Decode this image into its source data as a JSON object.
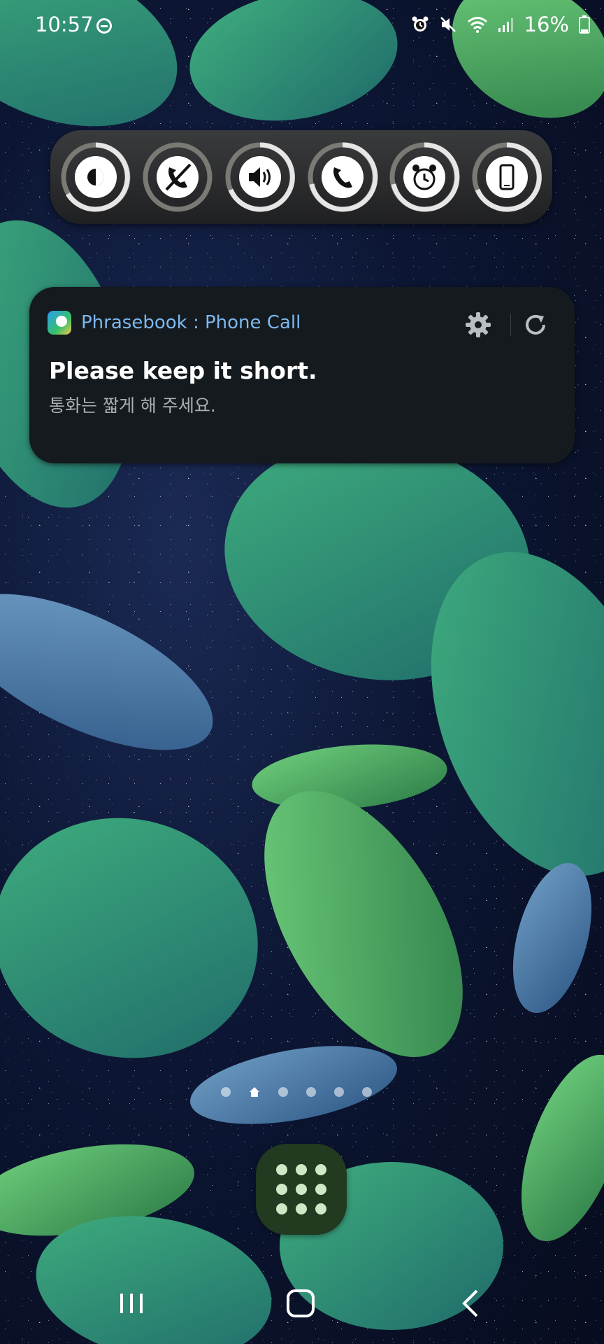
{
  "status_bar": {
    "time": "10:57",
    "battery": "16%"
  },
  "quick_toggles": [
    {
      "icon": "brightness-icon"
    },
    {
      "icon": "call-block-icon"
    },
    {
      "icon": "volume-icon"
    },
    {
      "icon": "phone-icon"
    },
    {
      "icon": "alarm-icon"
    },
    {
      "icon": "phone-device-icon"
    }
  ],
  "notification": {
    "app_name": "Phrasebook : Phone Call",
    "title": "Please keep it short.",
    "subtitle": "통화는 짧게 해 주세요."
  },
  "home": {
    "page_count": 6,
    "current_page": 2
  },
  "colors": {
    "accent": "#7db8f0",
    "card_bg": "#141a1e",
    "apps_button": "#213a20"
  }
}
